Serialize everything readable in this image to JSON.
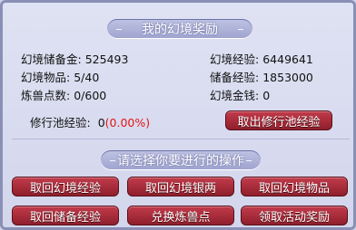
{
  "title": "我的幻境奖励",
  "section_title": "请选择你要进行的操作",
  "stats_left": [
    {
      "label": "幻境储备金:",
      "value": "525493"
    },
    {
      "label": "幻境物品:",
      "value": "5/40"
    },
    {
      "label": "炼兽点数:",
      "value": "0/600"
    }
  ],
  "stats_right": [
    {
      "label": "幻境经验:",
      "value": "6449641"
    },
    {
      "label": "储备经验:",
      "value": "1853000"
    },
    {
      "label": "幻境金钱:",
      "value": "0"
    }
  ],
  "pool": {
    "label": "修行池经验:",
    "value": "0",
    "pct": "(0.00%)",
    "button": "取出修行池经验"
  },
  "actions": [
    "取回幻境经验",
    "取回幻境银两",
    "取回幻境物品",
    "取回储备经验",
    "兑换炼兽点",
    "领取活动奖励"
  ],
  "colors": {
    "button": "#a72c3b",
    "panel": "#d8dbef",
    "header": "#aeb2d9",
    "percent": "#e21515"
  }
}
